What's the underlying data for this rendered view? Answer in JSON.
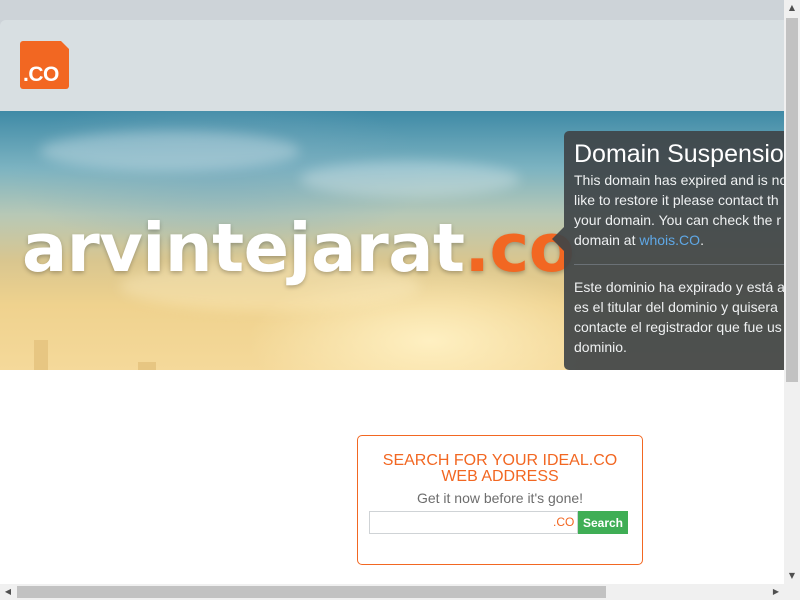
{
  "logo": {
    "text": ".CO"
  },
  "hero": {
    "domain_base": "arvintejarat",
    "domain_tld": ".co"
  },
  "popup": {
    "title": "Domain Suspension",
    "en_line1": "This domain has expired and is no",
    "en_line2": "like to restore it please contact th",
    "en_line3": "your domain. You can check the r",
    "en_line4_prefix": "domain at ",
    "en_link": "whois.CO",
    "en_line4_suffix": ".",
    "es_line1": "Este dominio ha expirado y está a",
    "es_line2": "es el titular del dominio y quisera",
    "es_line3": "contacte el registrador que fue us",
    "es_line4": "dominio."
  },
  "search": {
    "title": "SEARCH FOR YOUR IDEAL.CO WEB ADDRESS",
    "subtitle": "Get it now before it's gone!",
    "input_value": "",
    "suffix": ".CO",
    "button_label": "Search"
  },
  "colors": {
    "brand_orange": "#f26722",
    "search_green": "#3fae55",
    "link_blue": "#5fa8e6"
  },
  "scrollbars": {
    "vertical_arrow_up": "▲",
    "vertical_arrow_down": "▼",
    "horizontal_arrow_left": "◀",
    "horizontal_arrow_right": "▶"
  }
}
